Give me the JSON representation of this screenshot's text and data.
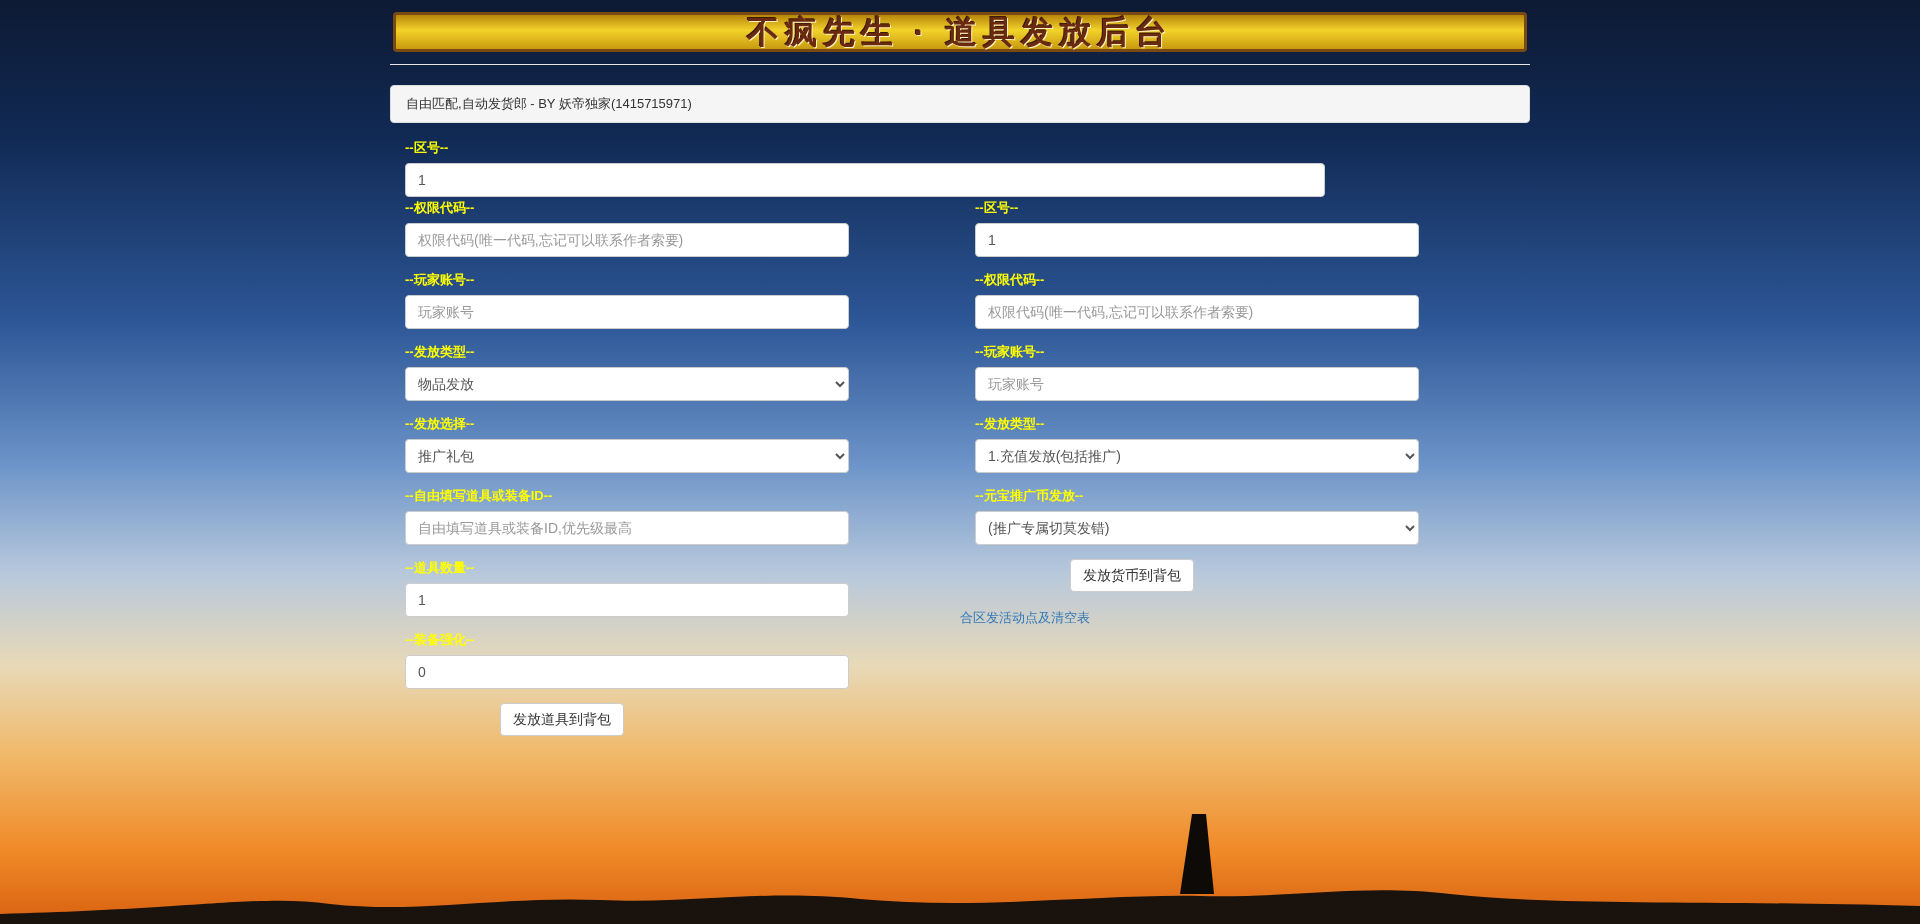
{
  "banner": {
    "title": "不疯先生 · 道具发放后台"
  },
  "notice": "自由匹配,自动发货郎 - BY 妖帝独家(1415715971)",
  "top_field": {
    "label": "--区号--",
    "value": "1"
  },
  "left_form": {
    "fields": [
      {
        "kind": "input",
        "label": "--权限代码--",
        "placeholder": "权限代码(唯一代码,忘记可以联系作者索要)"
      },
      {
        "kind": "input",
        "label": "--玩家账号--",
        "placeholder": "玩家账号"
      },
      {
        "kind": "select",
        "label": "--发放类型--",
        "value": "物品发放"
      },
      {
        "kind": "select",
        "label": "--发放选择--",
        "value": "推广礼包"
      },
      {
        "kind": "input",
        "label": "--自由填写道具或装备ID--",
        "placeholder": "自由填写道具或装备ID,优先级最高"
      },
      {
        "kind": "input",
        "label": "--道具数量--",
        "value": "1"
      },
      {
        "kind": "input",
        "label": "--装备强化--",
        "value": "0"
      }
    ],
    "button": "发放道具到背包"
  },
  "right_form": {
    "fields": [
      {
        "kind": "input",
        "label": "--区号--",
        "value": "1"
      },
      {
        "kind": "input",
        "label": "--权限代码--",
        "placeholder": "权限代码(唯一代码,忘记可以联系作者索要)"
      },
      {
        "kind": "input",
        "label": "--玩家账号--",
        "placeholder": "玩家账号"
      },
      {
        "kind": "select",
        "label": "--发放类型--",
        "value": "1.充值发放(包括推广)"
      },
      {
        "kind": "select",
        "label": "--元宝推广币发放--",
        "value": "(推广专属切莫发错)"
      }
    ],
    "button": "发放货币到背包",
    "link": "合区发活动点及清空表"
  }
}
